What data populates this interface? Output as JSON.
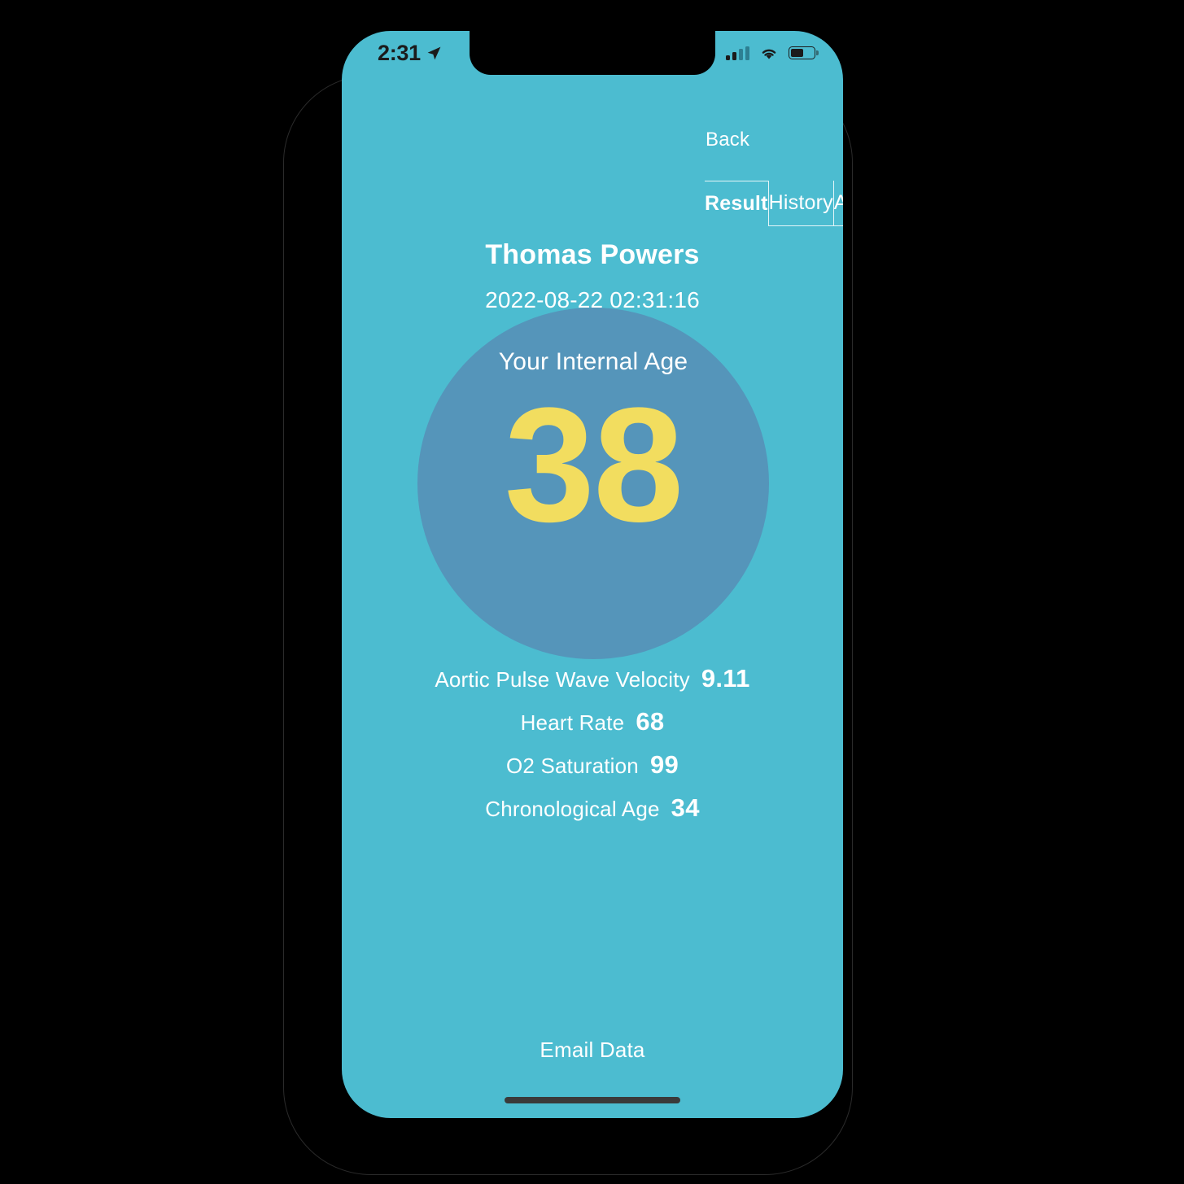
{
  "status_bar": {
    "time": "2:31",
    "location_icon": "location-arrow-icon",
    "signal_icon": "cellular-signal-icon",
    "wifi_icon": "wifi-icon",
    "battery_icon": "battery-icon",
    "battery_level_percent": 55
  },
  "nav": {
    "back_label": "Back"
  },
  "tabs": [
    {
      "label": "Result",
      "active": true
    },
    {
      "label": "History",
      "active": false
    },
    {
      "label": "Analysis",
      "active": false
    }
  ],
  "header": {
    "patient_name": "Thomas Powers",
    "timestamp": "2022-08-22 02:31:16"
  },
  "age_circle": {
    "label": "Your Internal Age",
    "value": "38"
  },
  "metrics": [
    {
      "label": "Aortic Pulse Wave Velocity",
      "value": "9.11"
    },
    {
      "label": "Heart Rate",
      "value": "68"
    },
    {
      "label": "O2 Saturation",
      "value": "99"
    },
    {
      "label": "Chronological Age",
      "value": "34"
    }
  ],
  "footer": {
    "email_label": "Email Data"
  },
  "colors": {
    "background": "#4cbcd0",
    "circle": "#5595ba",
    "accent_value": "#f2dd5f",
    "text": "#ffffff",
    "status_icon": "#1b1b1b",
    "home_indicator": "#3a3a3a"
  }
}
